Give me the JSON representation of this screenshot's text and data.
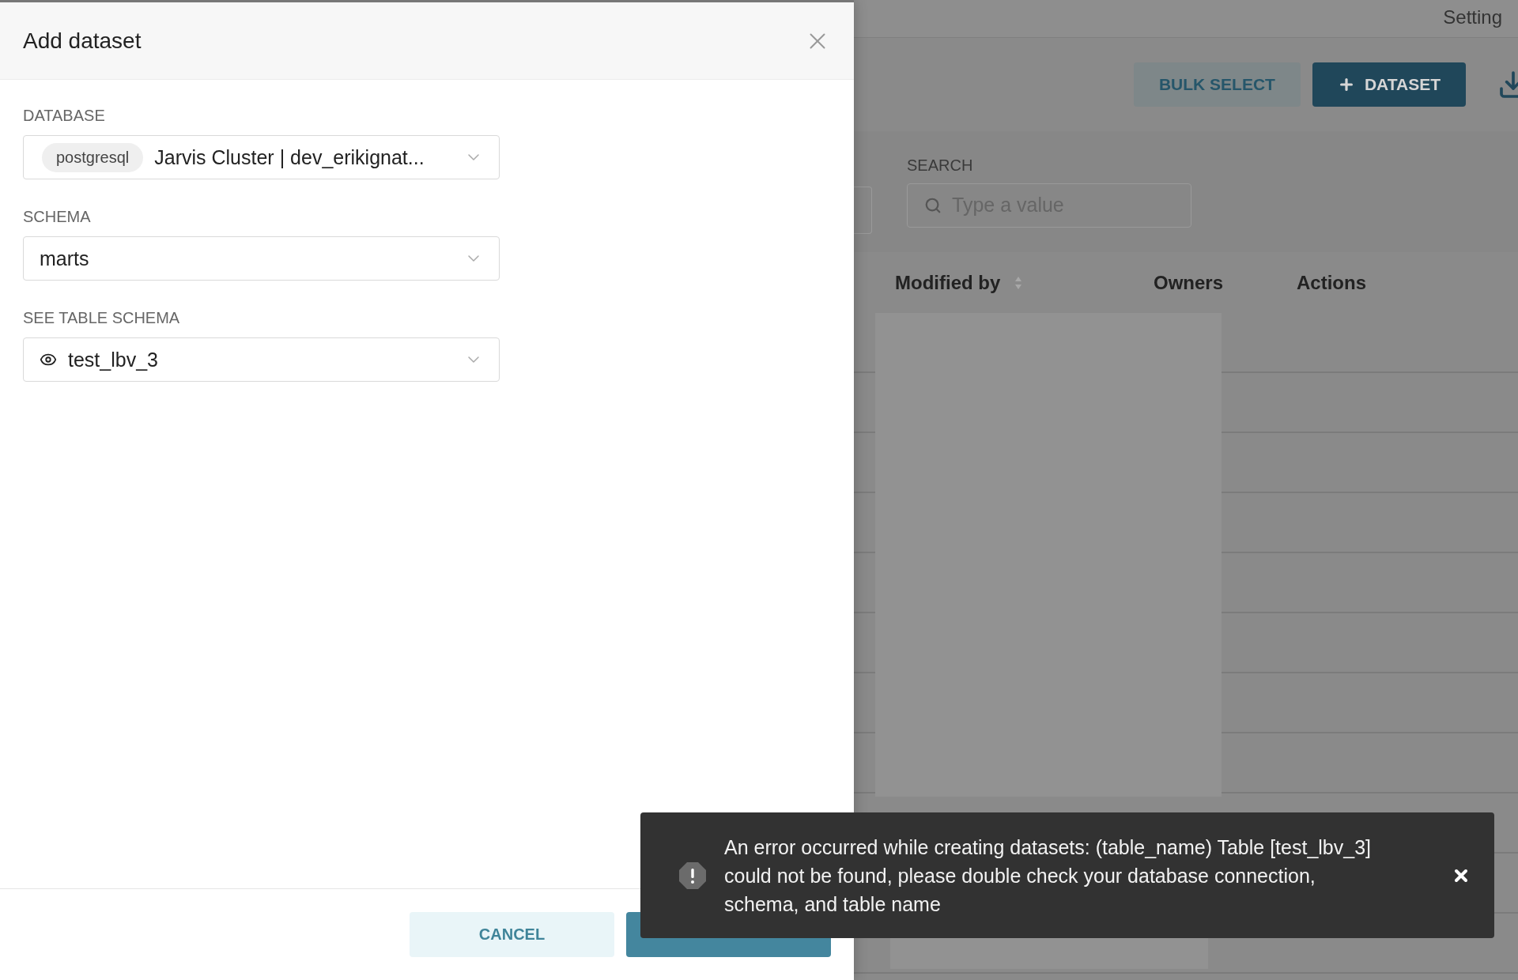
{
  "background_page": {
    "header_text": "Setting",
    "buttons": [
      {
        "label": "BULK SELECT",
        "kind": "secondary"
      },
      {
        "label": "DATASET",
        "kind": "primary"
      }
    ],
    "search": {
      "label": "SEARCH",
      "placeholder": "Type a value"
    },
    "table": {
      "columns": [
        {
          "label": "Modified by",
          "sortable": true
        },
        {
          "label": "Owners",
          "sortable": false
        },
        {
          "label": "Actions",
          "sortable": false
        }
      ]
    }
  },
  "dialog": {
    "title": "Add dataset",
    "fields": [
      {
        "label": "DATABASE",
        "kind": "database",
        "tag": "postgresql",
        "value": "Jarvis Cluster | dev_erikignat..."
      },
      {
        "label": "SCHEMA",
        "kind": "plain",
        "value": "marts"
      },
      {
        "label": "SEE TABLE SCHEMA",
        "kind": "table",
        "value": "test_lbv_3"
      }
    ],
    "buttons": [
      {
        "label": "CANCEL",
        "kind": "secondary"
      },
      {
        "kind": "primary"
      }
    ]
  },
  "toast": {
    "message": "An error occurred while creating datasets: (table_name) Table [test_lbv_3] could not be found, please double check your database connection, schema, and table name"
  }
}
